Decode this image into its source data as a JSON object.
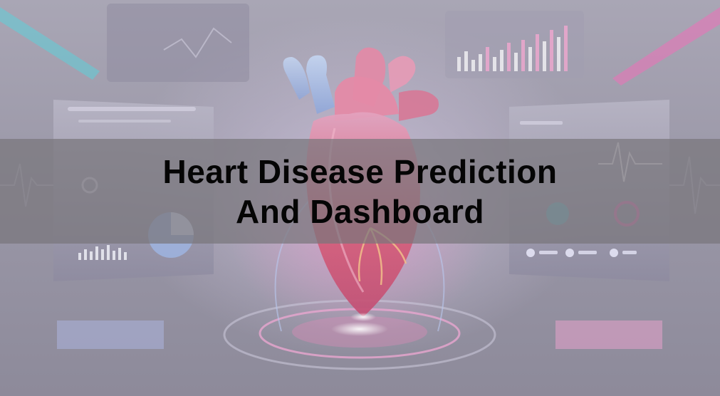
{
  "banner": {
    "title_line_1": "Heart Disease Prediction",
    "title_line_2": "And Dashboard"
  },
  "colors": {
    "banner_overlay": "#78767c",
    "title_text": "#050505",
    "accent_pink": "#e874b8",
    "accent_cyan": "#5fd0d8",
    "heart_red": "#d9607a",
    "heart_blue": "#9fb8e8"
  },
  "decor": {
    "icons": [
      "heart-illustration",
      "hologram-pedestal",
      "dashboard-panel",
      "bar-chart",
      "ecg-line"
    ]
  }
}
